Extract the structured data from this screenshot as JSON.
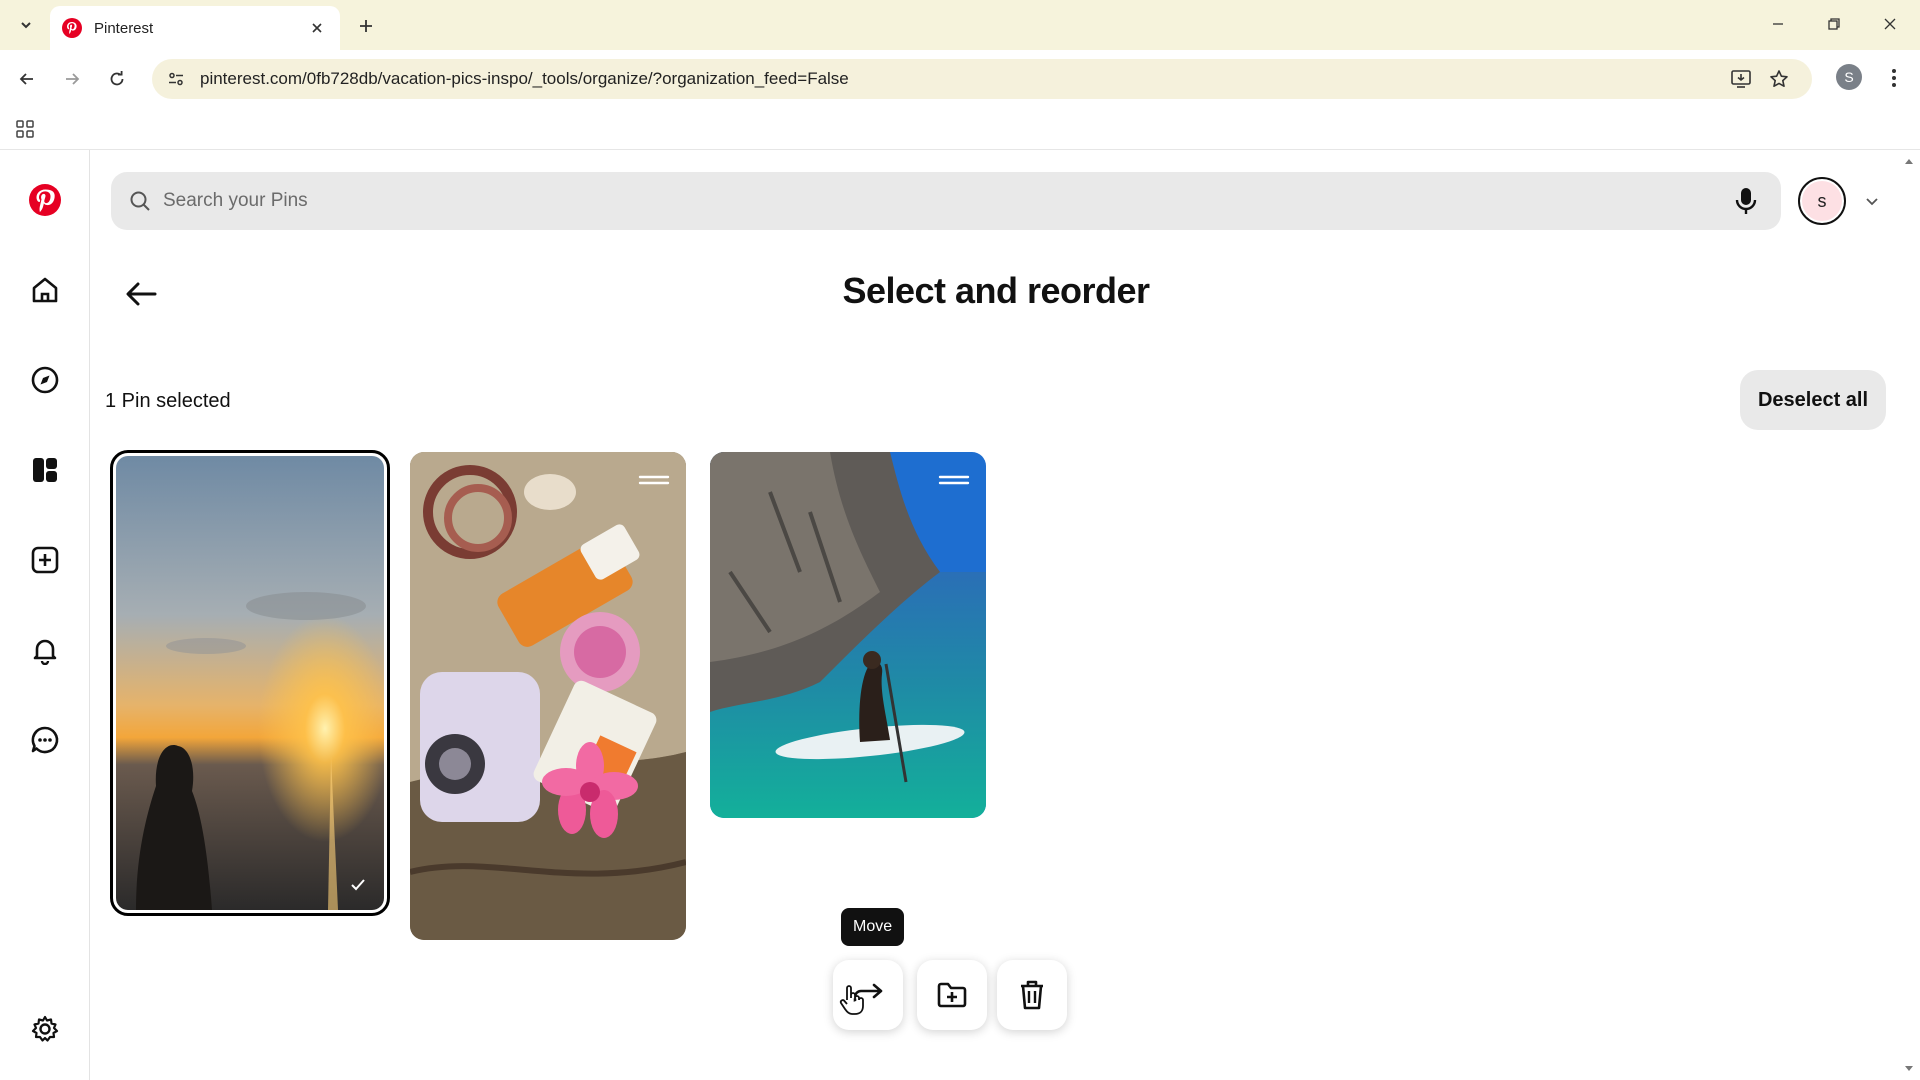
{
  "browser": {
    "tab_title": "Pinterest",
    "url": "pinterest.com/0fb728db/vacation-pics-inspo/_tools/organize/?organization_feed=False",
    "profile_initial": "S"
  },
  "search": {
    "placeholder": "Search your Pins"
  },
  "account": {
    "initial": "s"
  },
  "page": {
    "title": "Select and reorder",
    "selected_count_label": "1 Pin selected",
    "deselect_label": "Deselect all"
  },
  "pins": [
    {
      "description": "sunset over the sea with silhouette of woman in water",
      "selected": true
    },
    {
      "description": "camera, sunscreen, flower hair clip and beach accessories on straw bag",
      "selected": false
    },
    {
      "description": "woman paddleboarding in turquoise water beside a cliff",
      "selected": false
    }
  ],
  "action_bar": {
    "tooltip": "Move",
    "buttons": [
      "move",
      "add-to-board",
      "delete"
    ]
  },
  "colors": {
    "brand": "#e60023",
    "chrome_bg": "#f6f3dc",
    "search_bg": "#e9e9e9"
  }
}
